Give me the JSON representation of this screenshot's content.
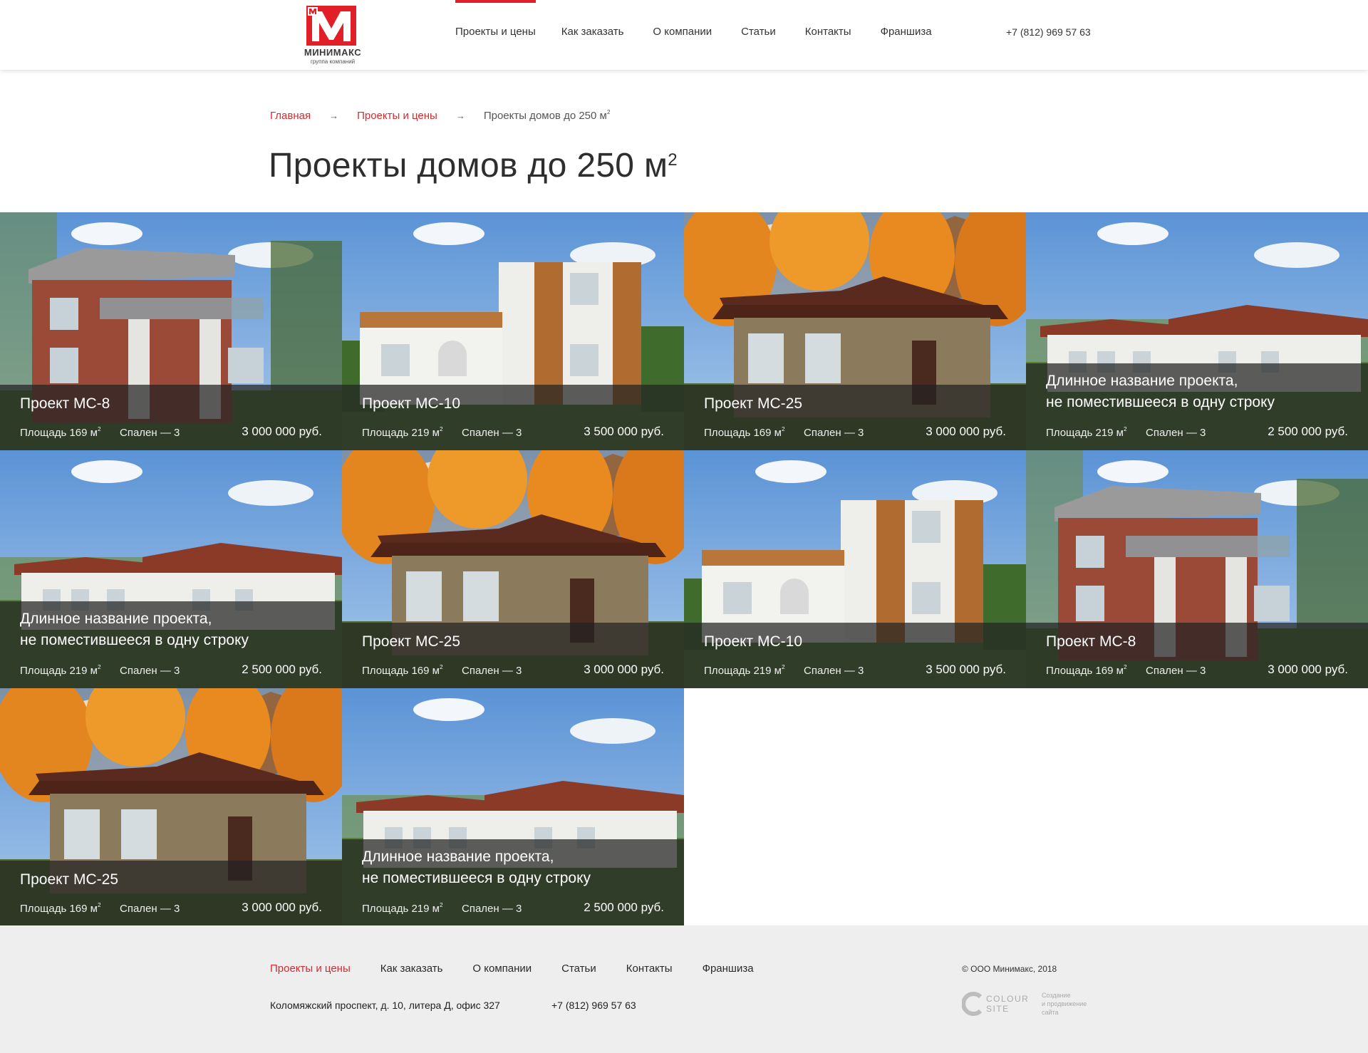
{
  "header": {
    "logo_name": "МИНИМАКС",
    "logo_sub": "группа компаний",
    "brand_color": "#e21e26",
    "nav": [
      "Проекты и цены",
      "Как заказать",
      "О компании",
      "Статьи",
      "Контакты",
      "Франшиза"
    ],
    "active_nav": 0,
    "phone": "+7 (812) 969 57 63"
  },
  "breadcrumb": {
    "home": "Главная",
    "section": "Проекты и цены",
    "current": "Проекты домов до 250 м",
    "current_sup": "2"
  },
  "page_title": "Проекты домов до 250 м",
  "page_title_sup": "2",
  "labels": {
    "area": "Площадь",
    "unit": "м",
    "unit_sup": "2",
    "bedrooms": "Спален — 3"
  },
  "projects": [
    {
      "title": "Проект МС-8",
      "area": "169",
      "bedrooms": "Спален — 3",
      "price": "3 000 000 руб.",
      "scene": "brick-summer"
    },
    {
      "title": "Проект МС-10",
      "area": "219",
      "bedrooms": "Спален — 3",
      "price": "3 500 000 руб.",
      "scene": "modern-summer"
    },
    {
      "title": "Проект МС-25",
      "area": "169",
      "bedrooms": "Спален — 3",
      "price": "3 000 000 руб.",
      "scene": "stone-autumn"
    },
    {
      "title": "Длинное название проекта, не поместившееся в одну строку",
      "area": "219",
      "bedrooms": "Спален — 3",
      "price": "2 500 000 руб.",
      "scene": "long-summer"
    },
    {
      "title": "Длинное название проекта, не поместившееся в одну строку",
      "area": "219",
      "bedrooms": "Спален — 3",
      "price": "2 500 000 руб.",
      "scene": "long-summer"
    },
    {
      "title": "Проект МС-25",
      "area": "169",
      "bedrooms": "Спален — 3",
      "price": "3 000 000 руб.",
      "scene": "stone-autumn"
    },
    {
      "title": "Проект МС-10",
      "area": "219",
      "bedrooms": "Спален — 3",
      "price": "3 500 000 руб.",
      "scene": "modern-summer"
    },
    {
      "title": "Проект МС-8",
      "area": "169",
      "bedrooms": "Спален — 3",
      "price": "3 000 000 руб.",
      "scene": "brick-summer"
    },
    {
      "title": "Проект МС-25",
      "area": "169",
      "bedrooms": "Спален — 3",
      "price": "3 000 000 руб.",
      "scene": "stone-autumn"
    },
    {
      "title": "Длинное название проекта, не поместившееся в одну строку",
      "area": "219",
      "bedrooms": "Спален — 3",
      "price": "2 500 000 руб.",
      "scene": "long-summer"
    }
  ],
  "footer": {
    "nav": [
      "Проекты и цены",
      "Как заказать",
      "О компании",
      "Статьи",
      "Контакты",
      "Франшиза"
    ],
    "address": "Коломяжский проспект, д. 10, литера Д, офис 327",
    "phone": "+7 (812) 969 57 63",
    "copyright": "© ООО Минимакс, 2018",
    "dev_name_1": "COLOUR",
    "dev_name_2": "SITE",
    "dev_desc_1": "Создание",
    "dev_desc_2": "и продвижение",
    "dev_desc_3": "сайта"
  }
}
